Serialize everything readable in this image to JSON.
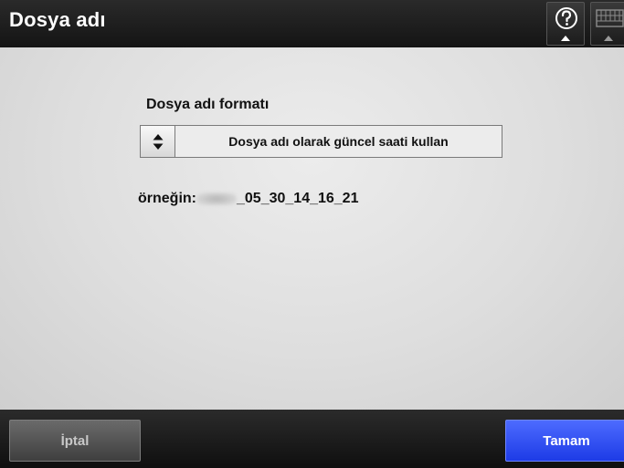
{
  "header": {
    "title": "Dosya adı",
    "help_icon": "question-circle-icon",
    "keyboard_icon": "keyboard-icon"
  },
  "main": {
    "format_label": "Dosya adı formatı",
    "format_select": {
      "value": "Dosya adı olarak güncel saati kullan",
      "icon": "up-down-arrows-icon"
    },
    "example": {
      "prefix": "örneğin:",
      "value": "_05_30_14_16_21"
    }
  },
  "footer": {
    "cancel_label": "İptal",
    "ok_label": "Tamam"
  },
  "colors": {
    "titlebar": "#1e1e1e",
    "ok_button": "#2a48f5",
    "cancel_button": "#555555",
    "background": "#dddddd"
  }
}
